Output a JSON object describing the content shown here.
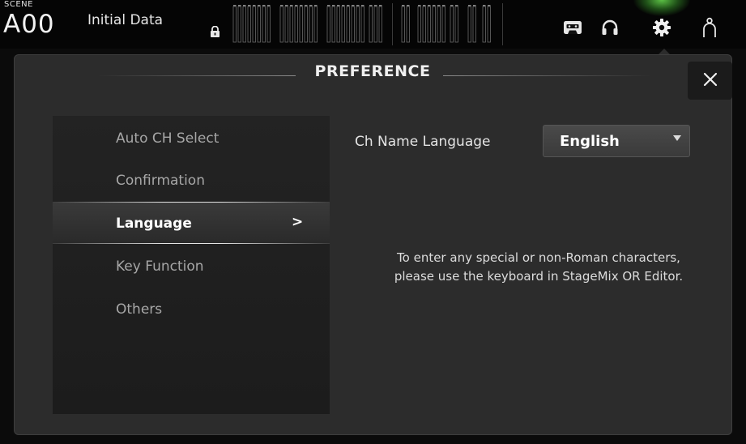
{
  "topbar": {
    "scene_label": "SCENE",
    "scene_number": "A00",
    "scene_name": "Initial Data",
    "icons": [
      "lock-icon",
      "cassette-icon",
      "headphones-icon",
      "gear-icon",
      "user-icon"
    ],
    "active_color": "#6cff4a"
  },
  "panel": {
    "title": "PREFERENCE",
    "close_icon": "close-icon"
  },
  "menu": {
    "items": [
      {
        "label": "Auto CH Select",
        "selected": false
      },
      {
        "label": "Confirmation",
        "selected": false
      },
      {
        "label": "Language",
        "selected": true
      },
      {
        "label": "Key Function",
        "selected": false
      },
      {
        "label": "Others",
        "selected": false
      }
    ],
    "selected_arrow": ">"
  },
  "content": {
    "ch_name_language_label": "Ch Name Language",
    "language_select_value": "English",
    "note_line1": "To enter any special or non-Roman characters,",
    "note_line2": "please use the keyboard in StageMix OR Editor."
  }
}
